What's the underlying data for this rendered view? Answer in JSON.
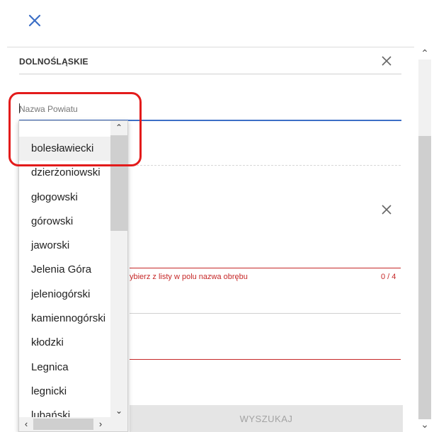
{
  "header": {
    "close_icon": "close-icon",
    "accent_color": "#3d6fc6"
  },
  "wojewodztwo": {
    "value": "DOLNOŚLĄSKIE",
    "clear_icon": "close-icon"
  },
  "powiat": {
    "placeholder": "Nazwa Powiatu",
    "value": ""
  },
  "powiat_options": [
    "bolesławiecki",
    "dzierżoniowski",
    "głogowski",
    "górowski",
    "jaworski",
    "Jelenia Góra",
    "jeleniogórski",
    "kamiennogórski",
    "kłodzki",
    "Legnica",
    "legnicki",
    "lubański"
  ],
  "selected_option": "bolesławiecki",
  "obreb": {
    "error_text": "ybierz z listy w polu nazwa obrębu",
    "counter": "0 / 4",
    "error_color": "#c62828"
  },
  "actions": {
    "search_label": "WYSZUKAJ"
  },
  "annotation": {
    "color": "#e31b1b"
  }
}
